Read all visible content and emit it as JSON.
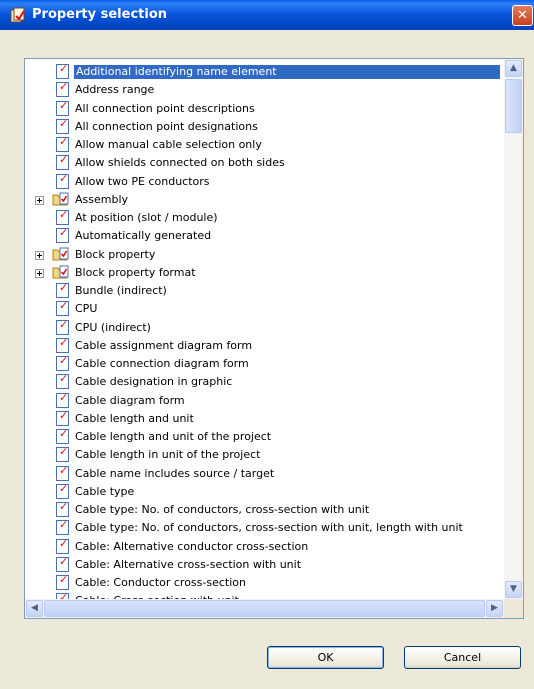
{
  "window": {
    "title": "Property selection",
    "close_glyph": "✕"
  },
  "tree": {
    "items": [
      {
        "label": "Additional identifying name element",
        "type": "property",
        "selected": true
      },
      {
        "label": "Address range",
        "type": "property"
      },
      {
        "label": "All connection point descriptions",
        "type": "property"
      },
      {
        "label": "All connection point designations",
        "type": "property"
      },
      {
        "label": "Allow manual cable selection only",
        "type": "property"
      },
      {
        "label": "Allow shields connected on both sides",
        "type": "property"
      },
      {
        "label": "Allow two PE conductors",
        "type": "property"
      },
      {
        "label": "Assembly",
        "type": "group"
      },
      {
        "label": "At position (slot / module)",
        "type": "property"
      },
      {
        "label": "Automatically generated",
        "type": "property"
      },
      {
        "label": "Block property",
        "type": "group"
      },
      {
        "label": "Block property format",
        "type": "group"
      },
      {
        "label": "Bundle (indirect)",
        "type": "property"
      },
      {
        "label": "CPU",
        "type": "property"
      },
      {
        "label": "CPU (indirect)",
        "type": "property"
      },
      {
        "label": "Cable assignment diagram form",
        "type": "property"
      },
      {
        "label": "Cable connection diagram form",
        "type": "property"
      },
      {
        "label": "Cable designation in graphic",
        "type": "property"
      },
      {
        "label": "Cable diagram form",
        "type": "property"
      },
      {
        "label": "Cable length and unit",
        "type": "property"
      },
      {
        "label": "Cable length and unit of the project",
        "type": "property"
      },
      {
        "label": "Cable length in unit of the project",
        "type": "property"
      },
      {
        "label": "Cable name includes source / target",
        "type": "property"
      },
      {
        "label": "Cable type",
        "type": "property"
      },
      {
        "label": "Cable type: No. of conductors, cross-section with unit",
        "type": "property"
      },
      {
        "label": "Cable type: No. of conductors, cross-section with unit, length with unit",
        "type": "property"
      },
      {
        "label": "Cable: Alternative conductor cross-section",
        "type": "property"
      },
      {
        "label": "Cable: Alternative cross-section with unit",
        "type": "property"
      },
      {
        "label": "Cable: Conductor cross-section",
        "type": "property"
      },
      {
        "label": "Cable: Cross-section with unit",
        "type": "property"
      }
    ]
  },
  "scrollbars": {
    "up_arrow": "▲",
    "down_arrow": "▼",
    "left_arrow": "◀",
    "right_arrow": "▶"
  },
  "buttons": {
    "ok_label": "OK",
    "cancel_label": "Cancel"
  },
  "colors": {
    "titlebar": "#0a58dc",
    "selection": "#316ac5",
    "close_button": "#c8411e",
    "dialog_background": "#ece9d8"
  },
  "icons": {
    "window_icon": "property-selection-icon",
    "property_icon": "property-checked-icon",
    "group_icon": "property-group-icon",
    "expander_icon": "plus-expander-icon"
  }
}
